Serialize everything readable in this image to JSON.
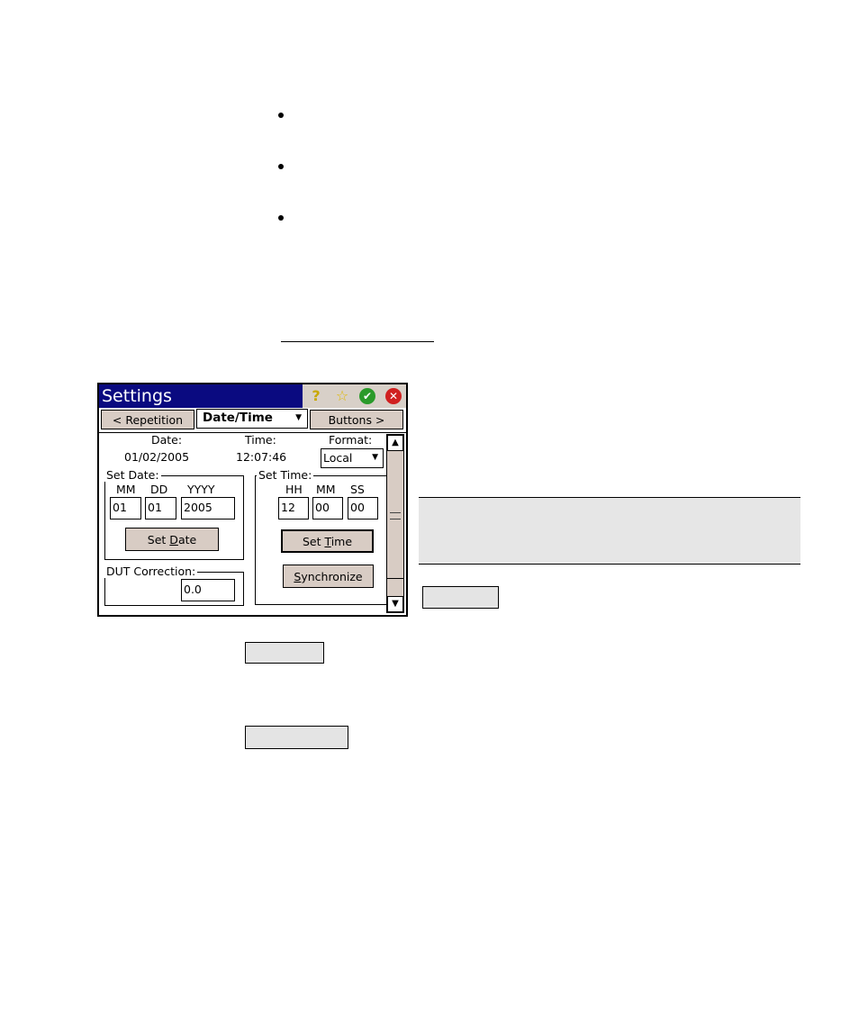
{
  "window": {
    "title": "Settings",
    "nav": {
      "prev_label": "< Repetition",
      "tab_label": "Date/Time",
      "next_label": "Buttons >"
    },
    "current": {
      "date_label": "Date:",
      "date_value": "01/02/2005",
      "time_label": "Time:",
      "time_value": "12:07:46",
      "format_label": "Format:",
      "format_value": "Local"
    },
    "set_date": {
      "group_label": "Set Date:",
      "mm_label": "MM",
      "dd_label": "DD",
      "yyyy_label": "YYYY",
      "mm_value": "01",
      "dd_value": "01",
      "yyyy_value": "2005",
      "button_pre": "Set ",
      "button_key": "D",
      "button_post": "ate"
    },
    "set_time": {
      "group_label": "Set Time:",
      "hh_label": "HH",
      "mm_label": "MM",
      "ss_label": "SS",
      "hh_value": "12",
      "mm_value": "00",
      "ss_value": "00",
      "button_pre": "Set ",
      "button_key": "T",
      "button_post": "ime",
      "sync_key": "S",
      "sync_post": "ynchronize"
    },
    "dut": {
      "group_label": "DUT Correction:",
      "value": "0.0"
    }
  },
  "icons": {
    "help": "help-icon",
    "star": "favorite-icon",
    "ok": "ok-icon",
    "close": "close-icon"
  },
  "colors": {
    "titlebar": "#0a0a80",
    "button": "#d8ccc4",
    "note_bg": "#e6e6e6"
  }
}
